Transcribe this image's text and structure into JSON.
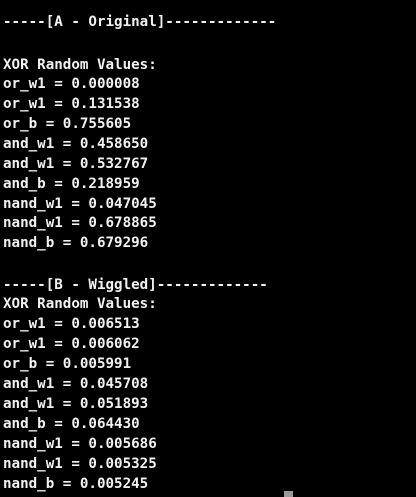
{
  "terminal": {
    "text_color": "#f2f2f2",
    "background_color": "#000000",
    "section_a": {
      "header": "-----[A - Original]-------------",
      "title": "XOR Random Values:",
      "lines": [
        "or_w1 = 0.000008",
        "or_w1 = 0.131538",
        "or_b = 0.755605",
        "and_w1 = 0.458650",
        "and_w1 = 0.532767",
        "and_b = 0.218959",
        "nand_w1 = 0.047045",
        "nand_w1 = 0.678865",
        "nand_b = 0.679296"
      ]
    },
    "section_b": {
      "header": "-----[B - Wiggled]-------------",
      "title": "XOR Random Values:",
      "lines": [
        "or_w1 = 0.006513",
        "or_w1 = 0.006062",
        "or_b = 0.005991",
        "and_w1 = 0.045708",
        "and_w1 = 0.051893",
        "and_b = 0.064430",
        "nand_w1 = 0.005686",
        "nand_w1 = 0.005325",
        "nand_b = 0.005245"
      ]
    }
  }
}
